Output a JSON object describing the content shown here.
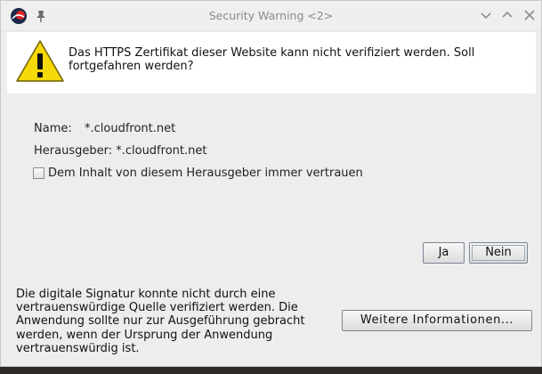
{
  "window": {
    "title": "Security Warning <2>"
  },
  "header": {
    "warning_text": "Das HTTPS Zertifikat dieser Website kann nicht verifiziert werden. Soll fortgefahren werden?"
  },
  "details": {
    "name_label": "Name:",
    "name_value": "*.cloudfront.net",
    "publisher_text": "Herausgeber: *.cloudfront.net",
    "trust_checkbox_label": "Dem Inhalt von diesem Herausgeber immer vertrauen",
    "trust_checked": false
  },
  "buttons": {
    "yes": "Ja",
    "no": "Nein",
    "more_info": "Weitere Informationen..."
  },
  "footer": {
    "signature_text": "Die digitale Signatur konnte nicht durch eine vertrauenswürdige Quelle verifiziert werden. Die Anwendung sollte nur zur Ausgeführung gebracht werden, wenn der Ursprung der Anwendung vertrauenswürdig ist."
  },
  "icons": {
    "app": "java-app-icon",
    "pin": "pin-icon",
    "minimize": "chevron-down-icon",
    "maximize": "chevron-up-icon",
    "close": "close-icon",
    "warning": "warning-triangle-icon"
  },
  "colors": {
    "warning_yellow": "#f5d90a",
    "window_bg": "#ededed",
    "button_border": "#7b8696"
  }
}
